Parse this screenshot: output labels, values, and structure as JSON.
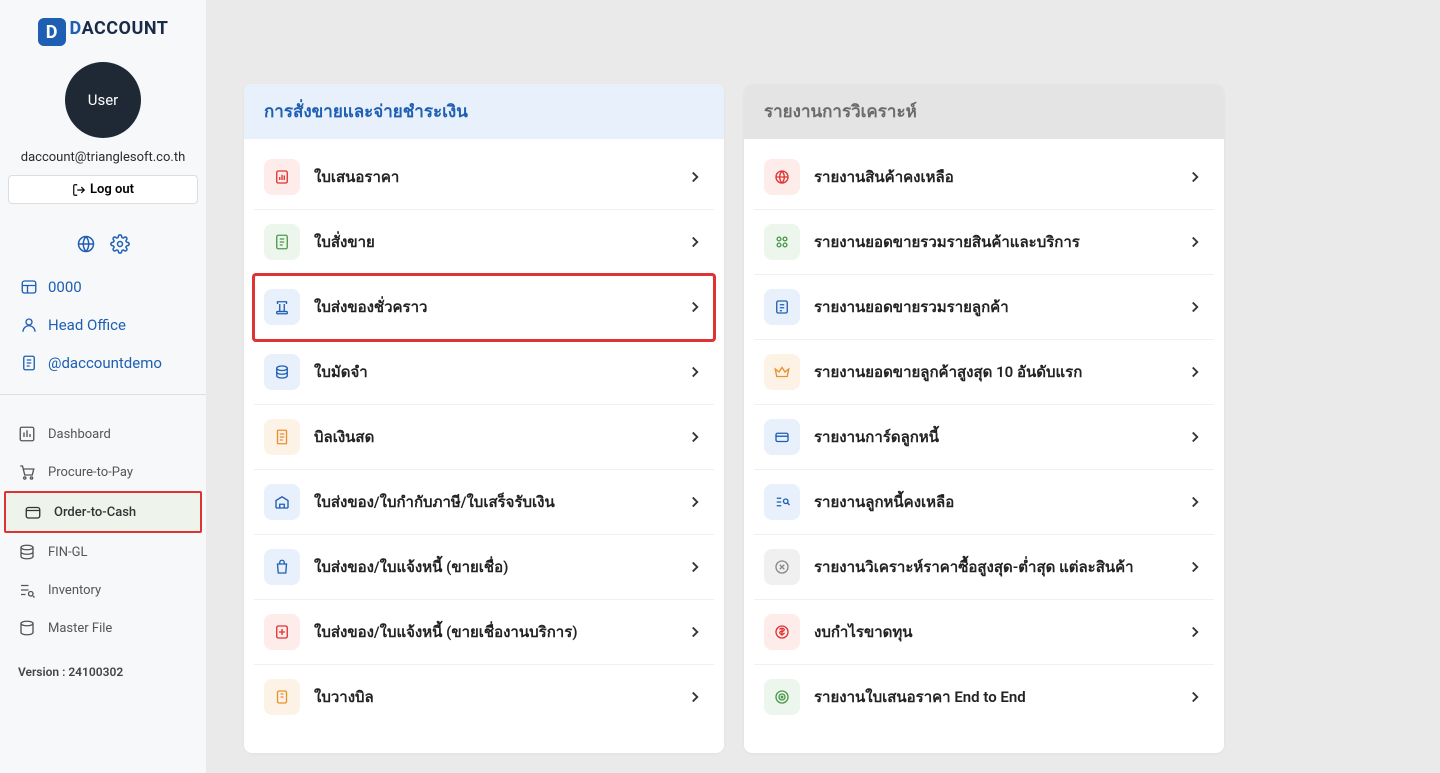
{
  "logo": {
    "brand_d": "D",
    "brand_rest": "ACCOUNT"
  },
  "profile": {
    "avatar_label": "User",
    "email": "daccount@trianglesoft.co.th",
    "logout_label": "Log out"
  },
  "meta": {
    "code": "0000",
    "office": "Head Office",
    "handle": "@daccountdemo"
  },
  "nav": {
    "dashboard": "Dashboard",
    "p2p": "Procure-to-Pay",
    "o2c": "Order-to-Cash",
    "fingl": "FIN-GL",
    "inventory": "Inventory",
    "master": "Master File"
  },
  "version": "Version : 24100302",
  "panel_left": {
    "header": "การสั่งขายและจ่ายชำระเงิน",
    "items": [
      "ใบเสนอราคา",
      "ใบสั่งขาย",
      "ใบส่งของชั่วคราว",
      "ใบมัดจำ",
      "บิลเงินสด",
      "ใบส่งของ/ใบกำกับภาษี/ใบเสร็จรับเงิน",
      "ใบส่งของ/ใบแจ้งหนี้ (ขายเชื่อ)",
      "ใบส่งของ/ใบแจ้งหนี้ (ขายเชื่องานบริการ)",
      "ใบวางบิล"
    ]
  },
  "panel_right": {
    "header": "รายงานการวิเคราะห์",
    "items": [
      "รายงานสินค้าคงเหลือ",
      "รายงานยอดขายรวมรายสินค้าและบริการ",
      "รายงานยอดขายรวมรายลูกค้า",
      "รายงานยอดขายลูกค้าสูงสุด 10 อันดับแรก",
      "รายงานการ์ดลูกหนี้",
      "รายงานลูกหนี้คงเหลือ",
      "รายงานวิเคราะห์ราคาซื้อสูงสุด-ต่ำสุด แต่ละสินค้า",
      "งบกำไรขาดทุน",
      "รายงานใบเสนอราคา End to End"
    ]
  }
}
